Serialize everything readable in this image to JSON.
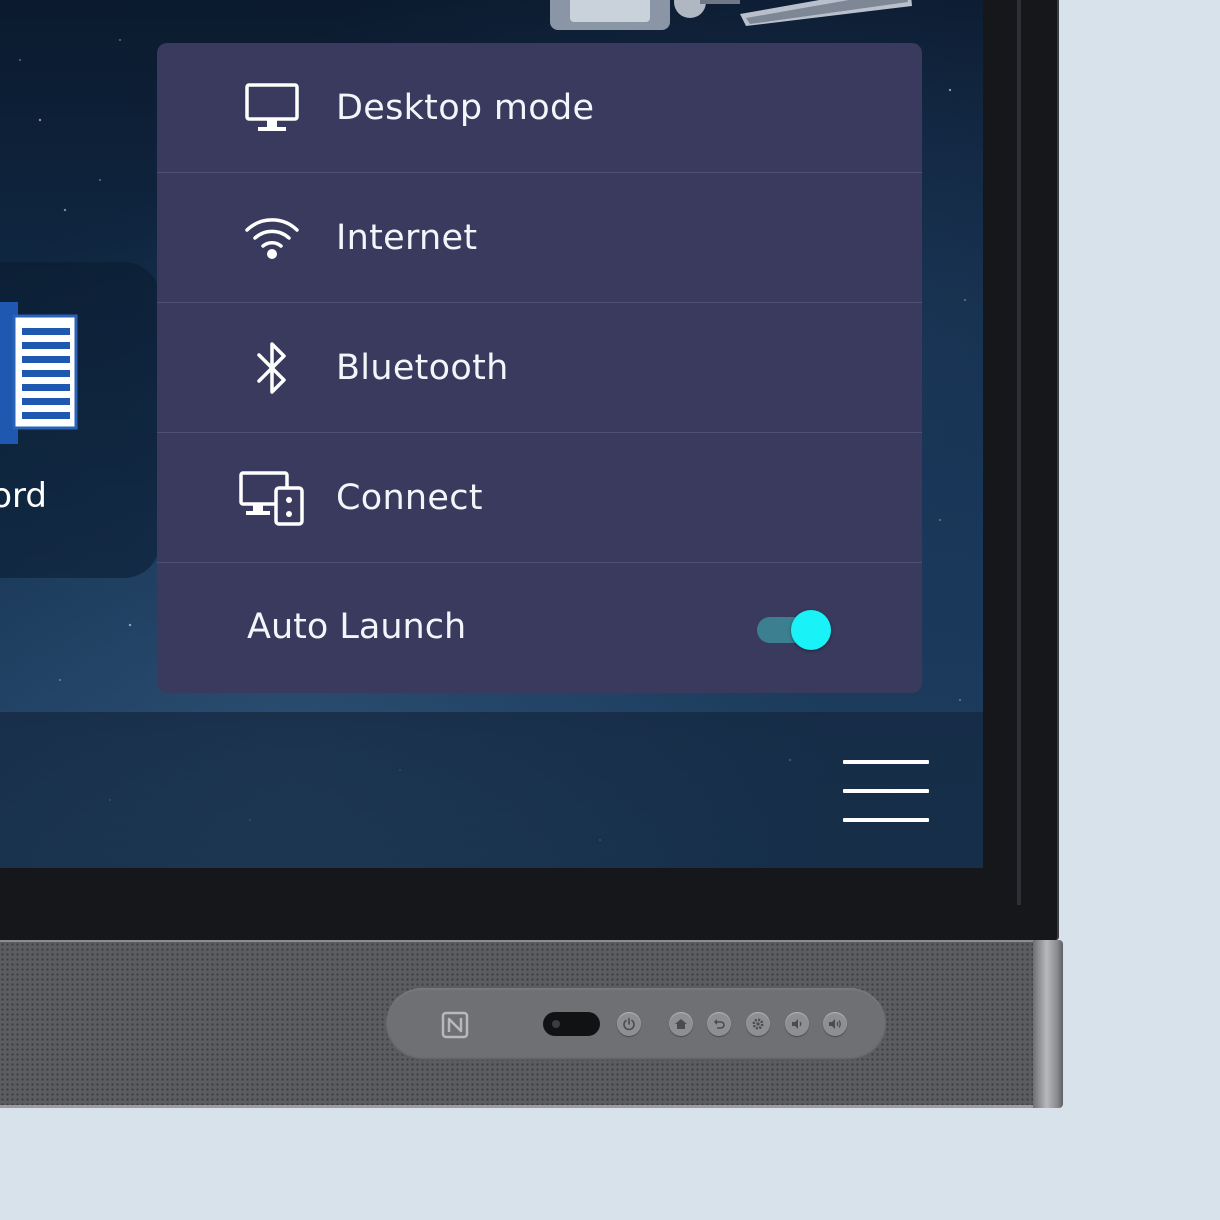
{
  "menu": {
    "items": [
      {
        "label": "Desktop mode",
        "icon": "monitor-icon"
      },
      {
        "label": "Internet",
        "icon": "wifi-icon"
      },
      {
        "label": "Bluetooth",
        "icon": "bluetooth-icon"
      },
      {
        "label": "Connect",
        "icon": "connect-devices-icon"
      }
    ],
    "auto_launch": {
      "label": "Auto Launch",
      "enabled": true
    }
  },
  "apps": [
    {
      "label": "ord",
      "icon": "word-document-icon"
    }
  ],
  "colors": {
    "panel": "#393a5d",
    "toggle_knob": "#19f2f6",
    "toggle_track": "#3b7f90"
  },
  "hardware": {
    "buttons": [
      "nfc-icon",
      "power-icon",
      "home-icon",
      "back-icon",
      "settings-icon",
      "volume-down-icon",
      "volume-up-icon"
    ]
  }
}
